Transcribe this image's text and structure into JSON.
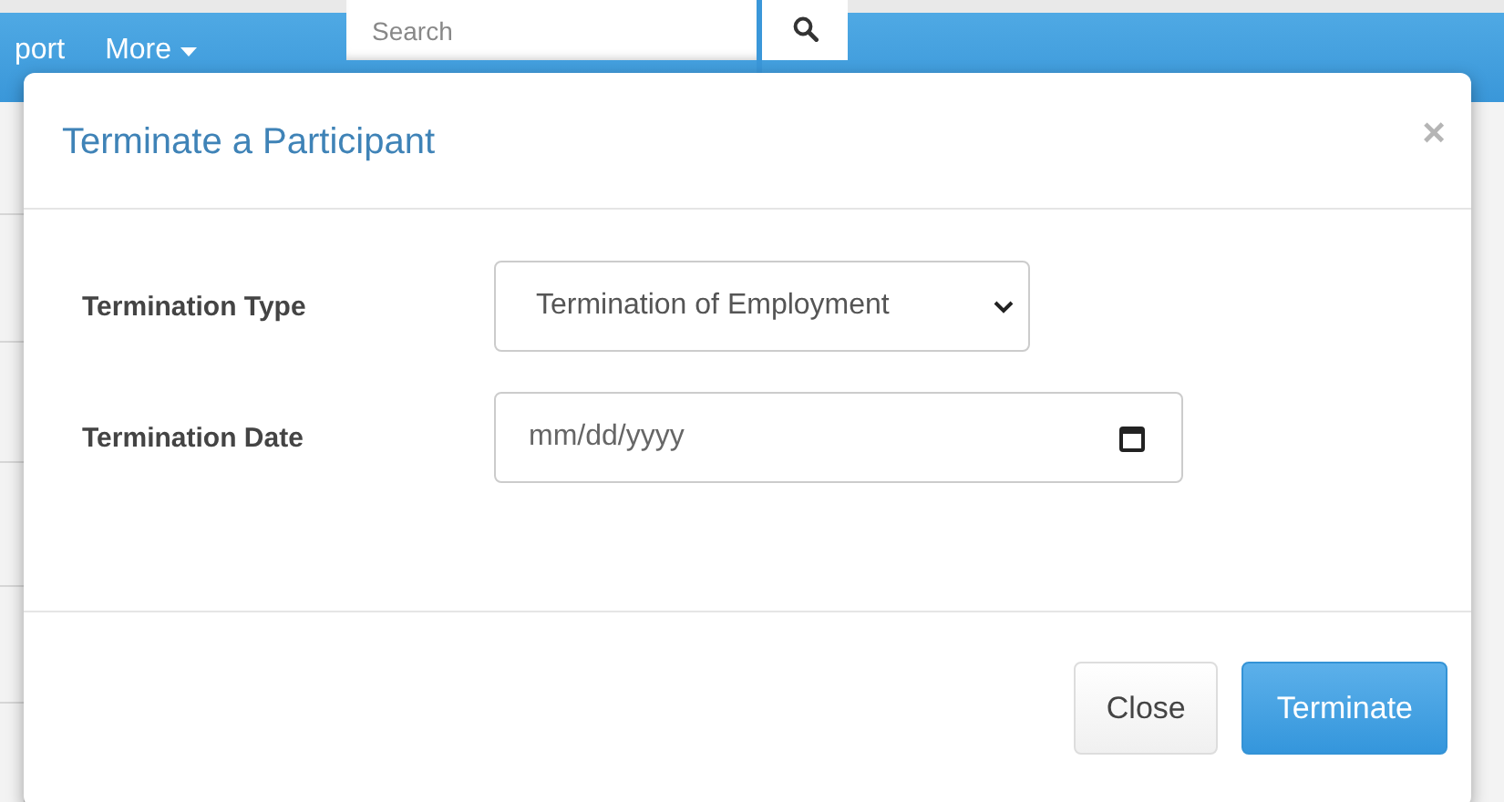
{
  "navbar": {
    "items": [
      {
        "label": "port",
        "kind": "link"
      },
      {
        "label": "More",
        "kind": "dropdown"
      }
    ],
    "search": {
      "placeholder": "Search"
    }
  },
  "modal": {
    "title": "Terminate a Participant",
    "close_glyph": "×",
    "fields": [
      {
        "label": "Termination Type",
        "kind": "select",
        "value": "Termination of Employment"
      },
      {
        "label": "Termination Date",
        "kind": "date",
        "placeholder": "mm/dd/yyyy"
      }
    ],
    "buttons": [
      {
        "label": "Close",
        "kind": "default"
      },
      {
        "label": "Terminate",
        "kind": "primary"
      }
    ]
  }
}
